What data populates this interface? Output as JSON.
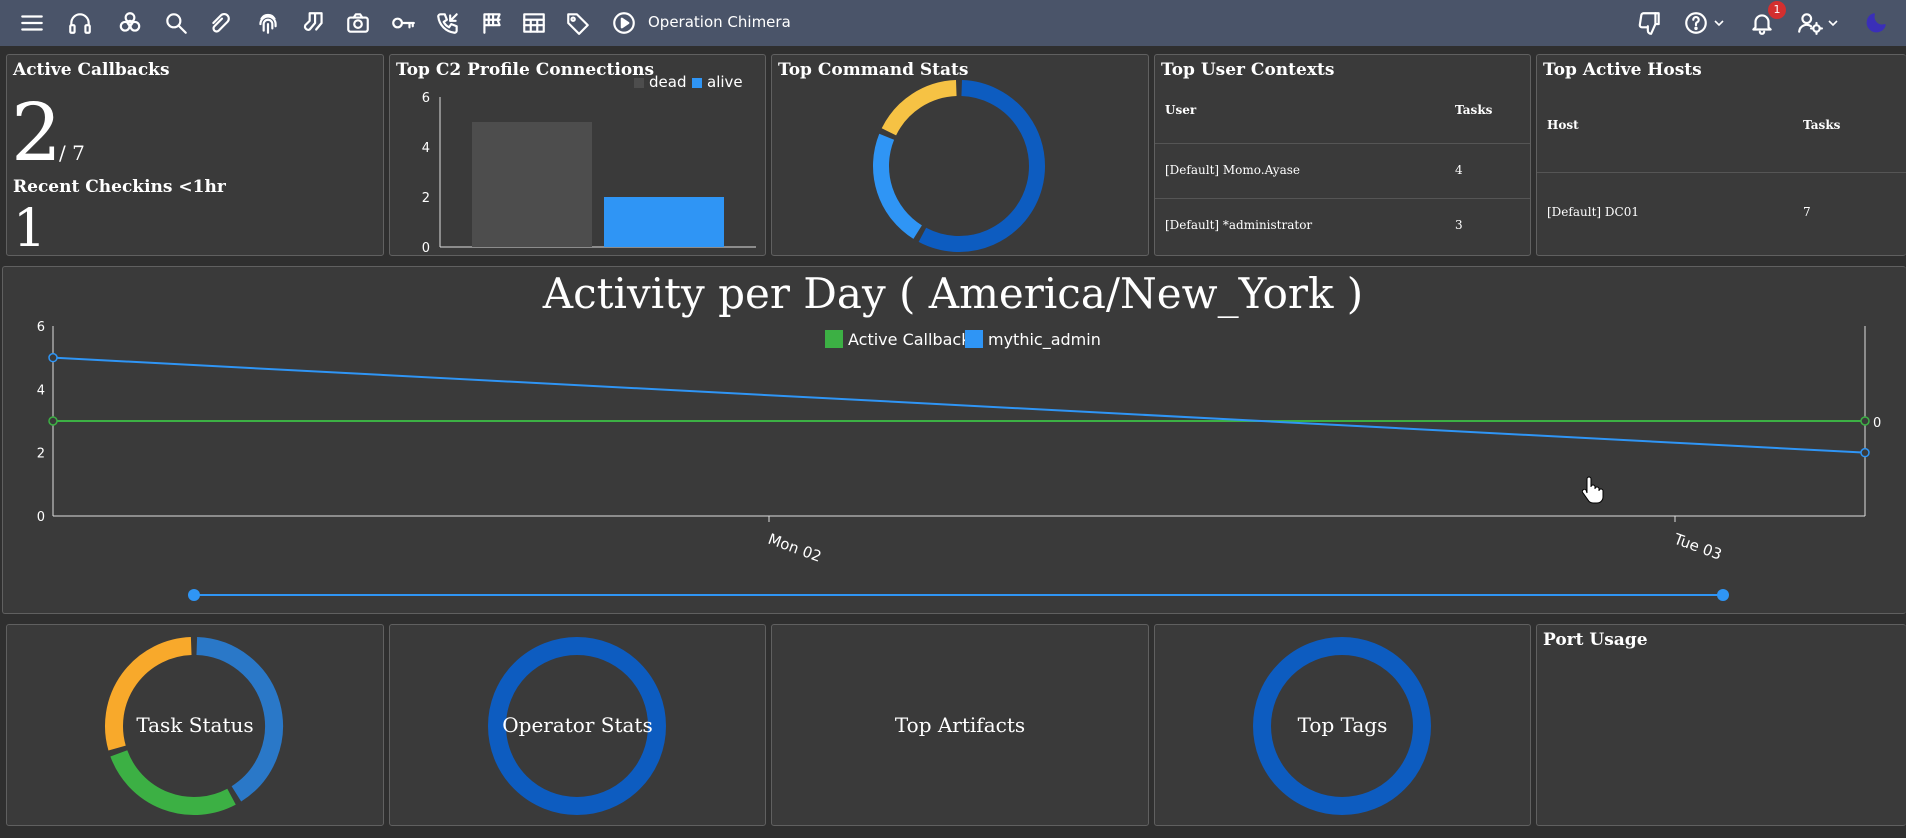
{
  "topbar": {
    "operation_name": "Operation Chimera",
    "notification_count": "1",
    "icons": [
      "menu-icon",
      "headphones-icon",
      "biohazard-icon",
      "search-icon",
      "paperclip-icon",
      "fingerprint-icon",
      "socks-icon",
      "camera-icon",
      "key-icon",
      "phone-callback-icon",
      "flag-checkered-icon",
      "table-icon",
      "tag-icon",
      "play-circle-icon",
      "thumbs-down-icon",
      "help-icon",
      "bell-icon",
      "user-settings-icon",
      "dark-mode-icon"
    ]
  },
  "active_callbacks": {
    "title": "Active Callbacks",
    "count": "2",
    "total": "/ 7",
    "recent_label": "Recent Checkins <1hr",
    "recent_count": "1"
  },
  "c2_profiles": {
    "title": "Top C2 Profile Connections",
    "legend": [
      "dead",
      "alive"
    ],
    "yticks": [
      "0",
      "2",
      "4",
      "6"
    ]
  },
  "command_stats": {
    "title": "Top Command Stats"
  },
  "user_contexts": {
    "title": "Top User Contexts",
    "headers": [
      "User",
      "Tasks"
    ],
    "rows": [
      {
        "user": "[Default] Momo.Ayase",
        "tasks": "4"
      },
      {
        "user": "[Default] *administrator",
        "tasks": "3"
      }
    ]
  },
  "active_hosts": {
    "title": "Top Active Hosts",
    "headers": [
      "Host",
      "Tasks"
    ],
    "rows": [
      {
        "host": "[Default] DC01",
        "tasks": "7"
      }
    ]
  },
  "activity": {
    "title": "Activity per Day ( America/New_York )",
    "legend": [
      "Active Callbacks",
      "mythic_admin"
    ],
    "yticks": [
      "0",
      "2",
      "4",
      "6"
    ],
    "xticks": [
      "Mon 02",
      "Tue 03"
    ],
    "right_label": "0"
  },
  "bottom_panels": {
    "task_status": "Task Status",
    "operator_stats": "Operator Stats",
    "top_artifacts": "Top Artifacts",
    "top_tags": "Top Tags",
    "port_usage": "Port Usage"
  },
  "colors": {
    "topbar": "#4a5469",
    "panel": "#3a3a3a",
    "blue": "#2f95f5",
    "dark_blue": "#0d5cc0",
    "orange": "#f8a92b",
    "green": "#3cb044",
    "yellow": "#f6c244",
    "dead_gray": "#4d4d4d"
  },
  "chart_data": [
    {
      "type": "bar",
      "title": "Top C2 Profile Connections",
      "categories": [
        "dead",
        "alive"
      ],
      "values": [
        5,
        2
      ],
      "ylim": [
        0,
        6
      ],
      "legend": "top-right"
    },
    {
      "type": "line",
      "title": "Activity per Day ( America/New_York )",
      "x": [
        "Mon 02",
        "Tue 03"
      ],
      "series": [
        {
          "name": "Active Callbacks",
          "values": [
            3,
            3
          ]
        },
        {
          "name": "mythic_admin",
          "values": [
            5,
            2
          ]
        }
      ],
      "ylim": [
        0,
        6
      ],
      "legend": "top-center"
    },
    {
      "type": "pie",
      "title": "Top Command Stats",
      "values": [
        75,
        25,
        15
      ]
    }
  ]
}
